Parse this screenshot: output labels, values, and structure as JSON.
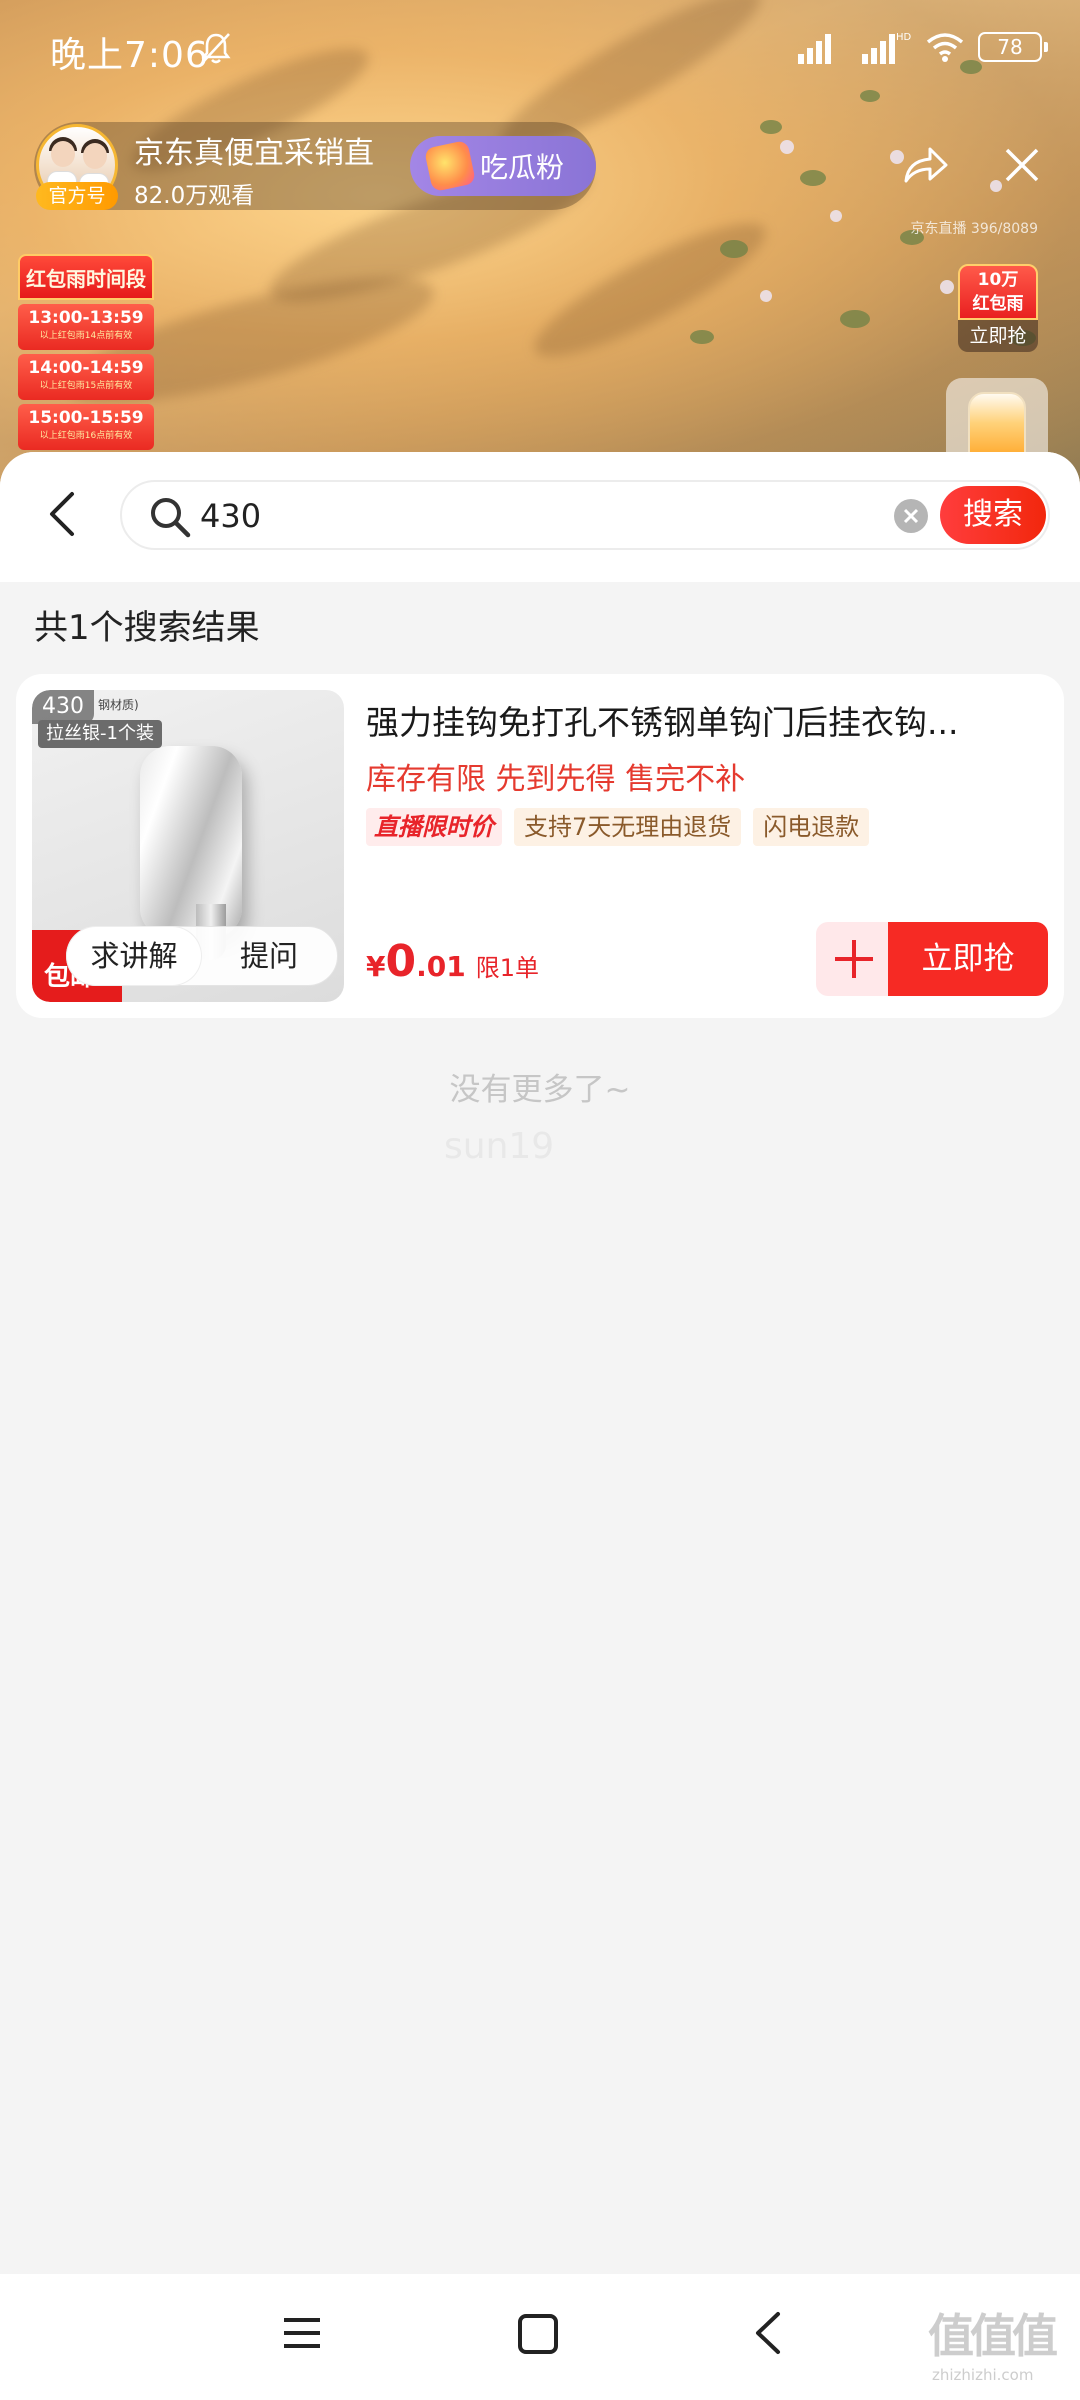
{
  "status_bar": {
    "time": "晚上7:06",
    "battery": "78"
  },
  "live": {
    "host_name": "京东真便宜采销直",
    "badge": "官方号",
    "viewers": "82.0万观看",
    "fan_button": "吃瓜粉",
    "room_id": "京东直播 396/8089"
  },
  "red_packet_rain": {
    "title": "红包雨时间段",
    "slots": [
      {
        "time": "13:00-13:59",
        "note": "以上红包雨14点前有效"
      },
      {
        "time": "14:00-14:59",
        "note": "以上红包雨15点前有效"
      },
      {
        "time": "15:00-15:59",
        "note": "以上红包雨16点前有效"
      }
    ],
    "widget_amount": "10万",
    "widget_name": "红包雨",
    "widget_action": "立即抢"
  },
  "search": {
    "query": "430",
    "button": "搜索"
  },
  "results": {
    "count_text": "共1个搜索结果",
    "end_text": "没有更多了~",
    "watermark": "sun19"
  },
  "product": {
    "index": "430",
    "image_tag": "拉丝银-1个装",
    "image_tag_small": "钢材质)",
    "ribbon": "包邮",
    "explain_label": "求讲解",
    "ask_label": "提问",
    "title": "强力挂钩免打孔不锈钢单钩门后挂衣钩...",
    "subtitle": "库存有限 先到先得 售完不补",
    "tags": [
      "直播限时价",
      "支持7天无理由退货",
      "闪电退款"
    ],
    "price_symbol": "¥",
    "price_int": "0",
    "price_dec": ".01",
    "price_limit": "限1单",
    "buy_label": "立即抢"
  },
  "site_watermark": {
    "logo": "值值值",
    "url": "zhizhizhi.com"
  },
  "icons": {
    "bell": "bell-muted-icon",
    "signal": "signal-icon",
    "wifi": "wifi-icon",
    "share": "share-icon",
    "close": "close-icon",
    "back": "back-arrow-icon",
    "search": "search-icon",
    "clear": "clear-icon",
    "menu": "menu-icon",
    "home": "home-icon",
    "nav_back": "nav-back-icon"
  }
}
